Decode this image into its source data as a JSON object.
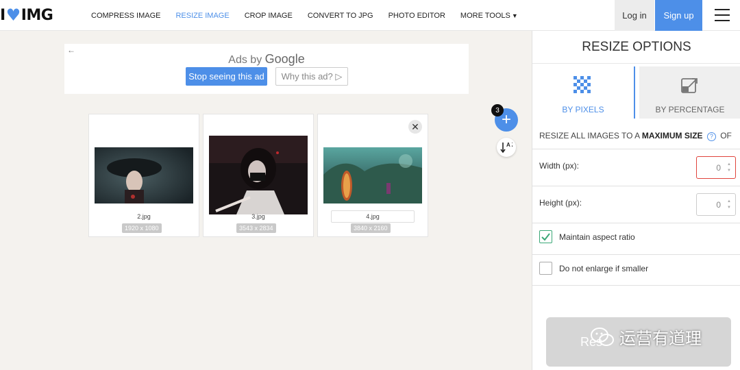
{
  "header": {
    "logo_left": "I",
    "logo_right": "IMG",
    "nav": [
      "COMPRESS IMAGE",
      "RESIZE IMAGE",
      "CROP IMAGE",
      "CONVERT TO JPG",
      "PHOTO EDITOR",
      "MORE TOOLS"
    ],
    "active_nav": "RESIZE IMAGE",
    "login": "Log in",
    "signup": "Sign up"
  },
  "ad": {
    "back_arrow": "←",
    "title_prefix": "Ads by",
    "title_brand": "Google",
    "stop_label": "Stop seeing this ad",
    "why_label": "Why this ad?",
    "why_icon": "▷"
  },
  "files": [
    {
      "name": "2.jpg",
      "size": "1920 x 1080"
    },
    {
      "name": "3.jpg",
      "size": "3543 x 2834"
    },
    {
      "name": "4.jpg",
      "size": "3840 x 2160"
    }
  ],
  "file_count": "3",
  "add_label": "+",
  "sort_label": "A Z",
  "sidebar": {
    "title": "RESIZE OPTIONS",
    "tab_pixels": "BY PIXELS",
    "tab_percentage": "BY PERCENTAGE",
    "resize_all_prefix": "RESIZE ALL IMAGES TO A",
    "resize_all_bold": "MAXIMUM SIZE",
    "resize_all_suffix": "OF",
    "help": "?",
    "width_label": "Width (px):",
    "width_value": "0",
    "height_label": "Height (px):",
    "height_value": "0",
    "maintain_label": "Maintain aspect ratio",
    "maintain_checked": true,
    "no_enlarge_label": "Do not enlarge if smaller",
    "no_enlarge_checked": false,
    "resize_button_partial": "Res"
  },
  "watermark": "运营有道理",
  "colors": {
    "accent": "#4d8fe8",
    "check": "#3aa776",
    "invalid": "#e0433b"
  }
}
